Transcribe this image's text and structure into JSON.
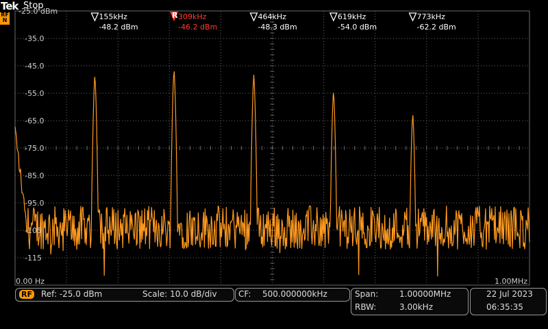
{
  "header": {
    "brand": "Tek",
    "status": "Stop",
    "rf_marker": "RF N"
  },
  "y_axis": {
    "labels": [
      "-25.0 dBm",
      "-35.0",
      "-45.0",
      "-55.0",
      "-65.0",
      "-75.0",
      "-85.0",
      "-95.0",
      "-105",
      "-115"
    ],
    "ref_dbm": -25.0,
    "scale_db_per_div": 10.0
  },
  "x_axis": {
    "start_label": "0.00 Hz",
    "stop_label": "1.00MHz"
  },
  "markers": [
    {
      "type": "delta",
      "freq": "155kHz",
      "level": "-48.2 dBm",
      "freq_khz": 155,
      "dbm": -48.2,
      "color": "#ffffff"
    },
    {
      "type": "reference",
      "symbol": "R",
      "freq": "309kHz",
      "level": "-46.2 dBm",
      "freq_khz": 309,
      "dbm": -46.2,
      "color": "#ff3b30"
    },
    {
      "type": "delta",
      "freq": "464kHz",
      "level": "-48.3 dBm",
      "freq_khz": 464,
      "dbm": -48.3,
      "color": "#ffffff"
    },
    {
      "type": "delta",
      "freq": "619kHz",
      "level": "-54.0 dBm",
      "freq_khz": 619,
      "dbm": -54.0,
      "color": "#ffffff"
    },
    {
      "type": "delta",
      "freq": "773kHz",
      "level": "-62.2 dBm",
      "freq_khz": 773,
      "dbm": -62.2,
      "color": "#ffffff"
    }
  ],
  "trace": {
    "color": "#ff9a1f",
    "noise_floor_dbm": -104,
    "span_khz": 1000
  },
  "bottom": {
    "rf_badge": "RF",
    "ref": "Ref: -25.0 dBm",
    "scale": "Scale: 10.0 dB/div",
    "cf_label": "CF:",
    "cf_value": "500.000000kHz",
    "span_label": "Span:",
    "span_value": "1.00000MHz",
    "rbw_label": "RBW:",
    "rbw_value": "3.00kHz",
    "date": "22 Jul  2023",
    "time": "06:35:35"
  },
  "colors": {
    "grid": "#6a6a6a",
    "trace": "#ff9a1f",
    "rf": "#ff9900",
    "ref_marker": "#ff3b30"
  }
}
